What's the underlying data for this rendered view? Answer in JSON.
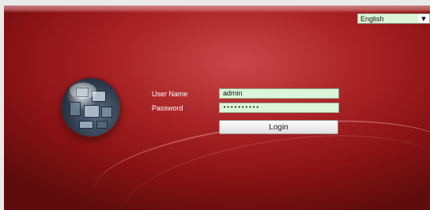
{
  "language": {
    "selected": "English"
  },
  "login": {
    "username_label": "User Name",
    "password_label": "Password",
    "username_value": "admin",
    "password_value": "••••••••••",
    "login_button": "Login"
  },
  "icons": {
    "logo": "globe-logo-icon",
    "dropdown": "chevron-down-icon"
  },
  "colors": {
    "panel_red": "#a82225",
    "field_green": "#dcf5d8"
  }
}
